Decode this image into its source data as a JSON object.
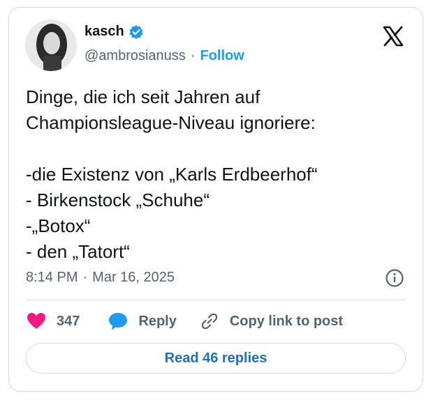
{
  "author": {
    "display_name": "kasch",
    "handle": "@ambrosianuss",
    "separator": "·",
    "follow_label": "Follow",
    "verified": true
  },
  "tweet": {
    "text": "Dinge, die ich seit Jahren auf\nChampionsleague-Niveau ignoriere:\n\n-die Existenz von „Karls Erdbeerhof“\n- Birkenstock „Schuhe“\n-„Botox“\n- den „Tatort“",
    "time": "8:14 PM",
    "separator": "·",
    "date": "Mar 16, 2025"
  },
  "actions": {
    "like_count": "347",
    "reply_label": "Reply",
    "copy_link_label": "Copy link to post"
  },
  "read_replies_label": "Read 46 replies",
  "icons": {
    "platform": "x-logo-icon",
    "verified": "verified-badge-icon",
    "info": "info-icon",
    "like": "heart-icon",
    "reply": "speech-bubble-icon",
    "copy_link": "link-icon"
  },
  "colors": {
    "accent": "#1d9bf0",
    "like": "#f91880",
    "text": "#0f1419",
    "muted": "#536471",
    "border": "#cfd9de"
  }
}
